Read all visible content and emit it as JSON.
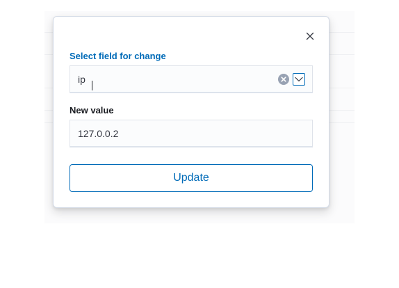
{
  "popover": {
    "close_icon": "close-icon",
    "select_field": {
      "label": "Select field for change",
      "value": "ip",
      "clear_icon": "clear-icon",
      "arrow_icon": "chevron-down-icon"
    },
    "new_value": {
      "label": "New value",
      "value": "127.0.0.2"
    },
    "update_label": "Update"
  },
  "colors": {
    "accent": "#006bb8",
    "label_text": "#1a1c21",
    "input_bg": "#fbfcfd",
    "border": "#d3dae6"
  }
}
